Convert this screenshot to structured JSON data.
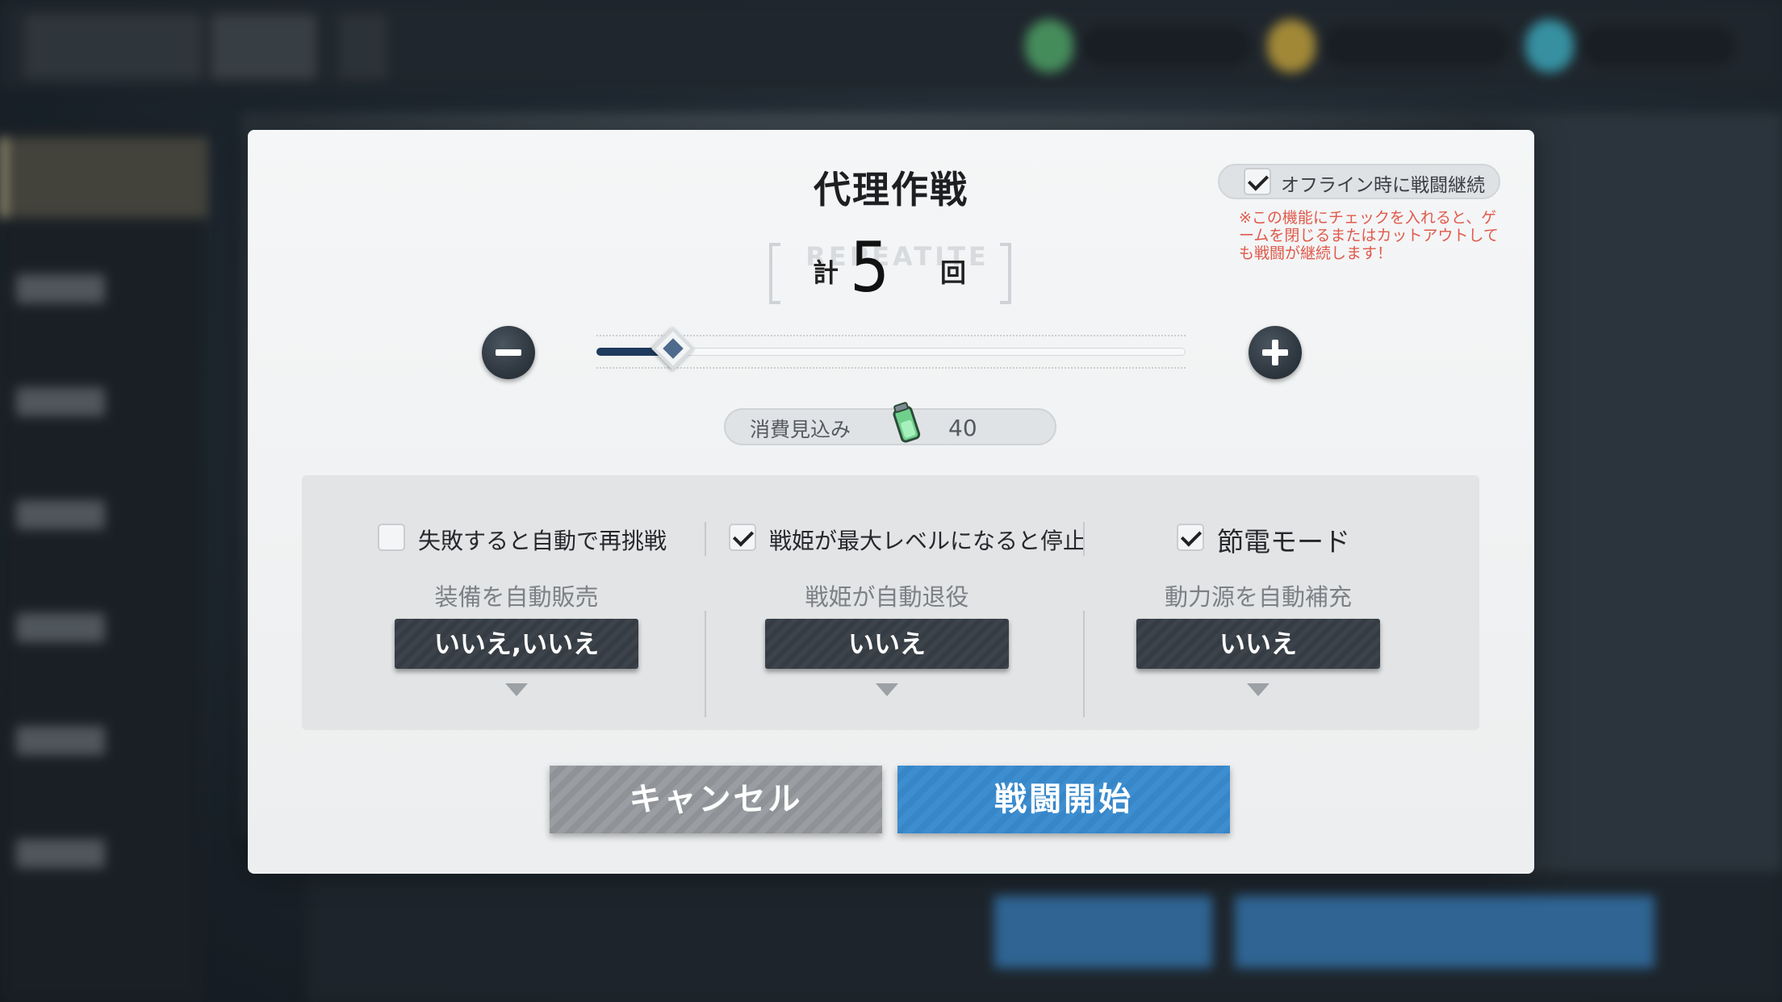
{
  "dialog": {
    "title": "代理作戦",
    "offline_continue": {
      "label": "オフライン時に戦闘継続",
      "checked": true
    },
    "offline_note": "※この機能にチェックを入れると、ゲームを閉じるまたはカットアウトしても戦闘が継続します！",
    "count": {
      "prefix": "計",
      "value": "5",
      "suffix": "回",
      "watermark": "REPEATITE"
    },
    "slider": {
      "level": 0.13
    },
    "cost": {
      "label": "消費見込み",
      "value": "40",
      "icon": "energy-battery-icon"
    },
    "options": {
      "retry_on_fail": {
        "label": "失敗すると自動で再挑戦",
        "checked": false
      },
      "stop_at_max_level": {
        "label": "戦姫が最大レベルになると停止",
        "checked": true
      },
      "power_saving": {
        "label": "節電モード",
        "checked": true
      }
    },
    "dropdowns": [
      {
        "label": "装備を自動販売",
        "value": "いいえ,いいえ"
      },
      {
        "label": "戦姫が自動退役",
        "value": "いいえ"
      },
      {
        "label": "動力源を自動補充",
        "value": "いいえ"
      }
    ],
    "buttons": {
      "cancel": "キャンセル",
      "start": "戦闘開始"
    }
  },
  "colors": {
    "accent": "#3d8ed0",
    "note_red": "#e05a4c",
    "slider_fill": "#1f3b5d"
  }
}
